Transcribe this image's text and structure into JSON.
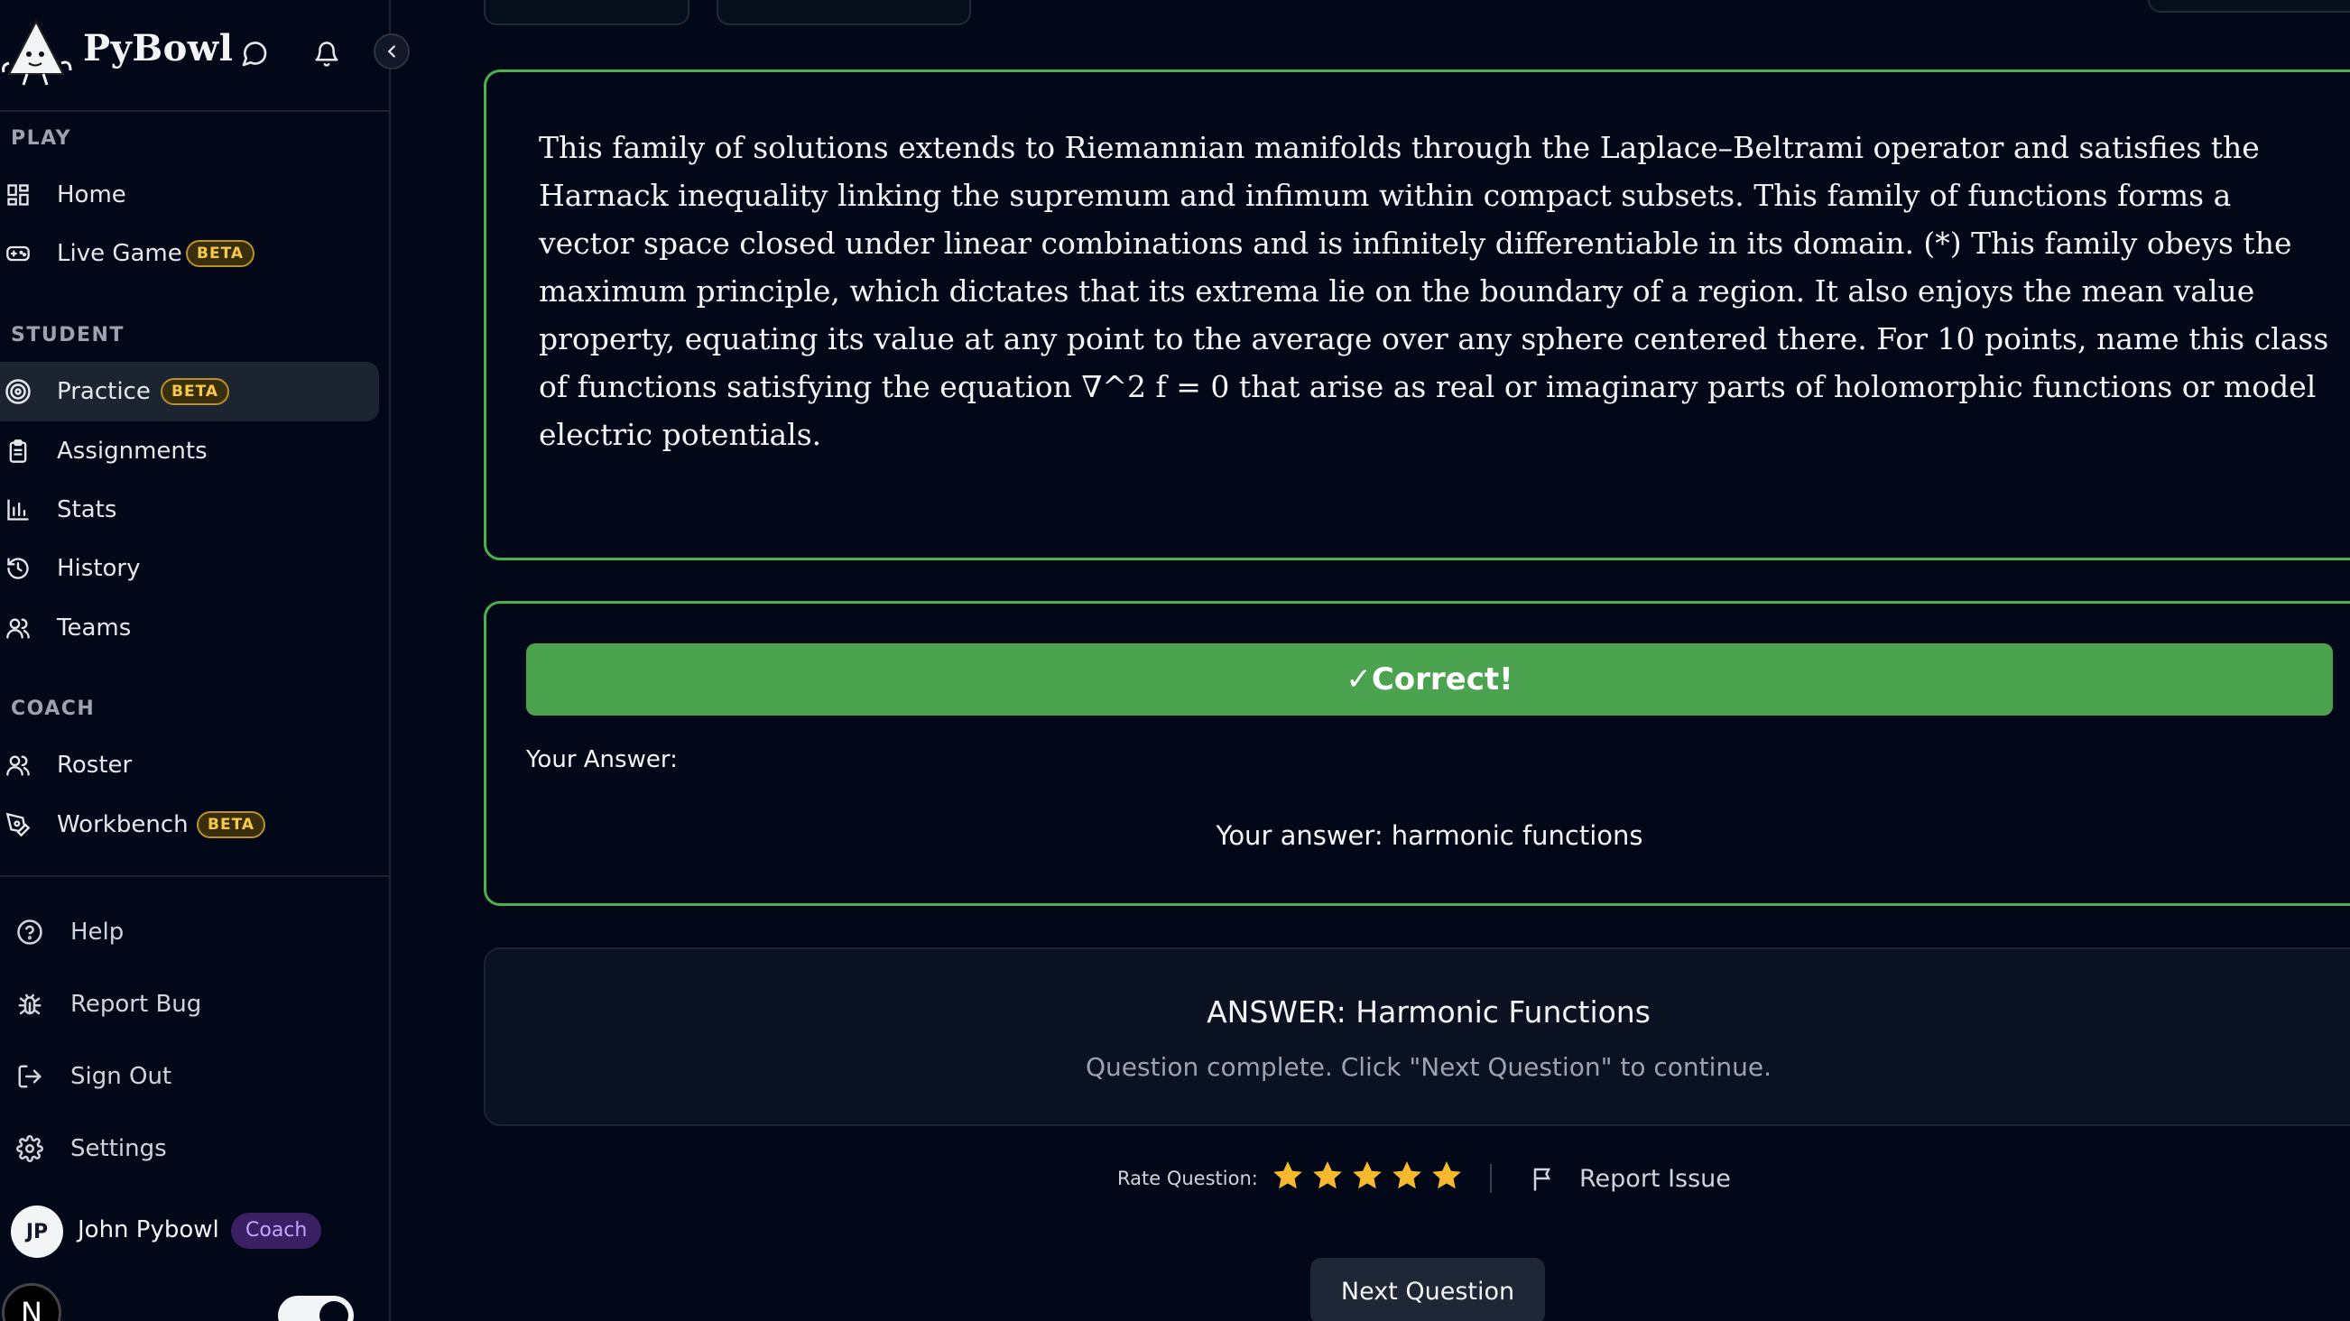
{
  "brand": {
    "name": "PyBowl"
  },
  "sidebar": {
    "sections": [
      {
        "title": "PLAY"
      },
      {
        "title": "STUDENT"
      },
      {
        "title": "COACH"
      }
    ],
    "play_items": [
      {
        "label": "Home",
        "icon": "grid-icon"
      },
      {
        "label": "Live Game",
        "icon": "gamepad-icon",
        "badge": "BETA"
      }
    ],
    "student_items": [
      {
        "label": "Practice",
        "icon": "target-icon",
        "badge": "BETA",
        "active": true
      },
      {
        "label": "Assignments",
        "icon": "clipboard-icon"
      },
      {
        "label": "Stats",
        "icon": "bar-chart-icon"
      },
      {
        "label": "History",
        "icon": "history-icon"
      },
      {
        "label": "Teams",
        "icon": "users-icon"
      }
    ],
    "coach_items": [
      {
        "label": "Roster",
        "icon": "users-icon"
      },
      {
        "label": "Workbench",
        "icon": "pen-tool-icon",
        "badge": "BETA"
      }
    ],
    "utility_items": [
      {
        "label": "Help",
        "icon": "help-circle-icon"
      },
      {
        "label": "Report Bug",
        "icon": "bug-icon"
      },
      {
        "label": "Sign Out",
        "icon": "log-out-icon"
      },
      {
        "label": "Settings",
        "icon": "gear-icon"
      }
    ],
    "user": {
      "initials": "JP",
      "name": "John Pybowl",
      "role": "Coach"
    },
    "n_badge": "N"
  },
  "question": {
    "text": "This family of solutions extends to Riemannian manifolds through the Laplace–Beltrami operator and satisfies the Harnack inequality linking the supremum and infimum within compact subsets. This family of functions forms a vector space closed under linear combinations and is infinitely differentiable in its domain. (*) This family obeys the maximum principle, which dictates that its extrema lie on the boundary of a region. It also enjoys the mean value property, equating its value at any point to the average over any sphere centered there. For 10 points, name this class of functions satisfying the equation ∇^2 f = 0 that arise as real or imaginary parts of holomorphic functions or model electric potentials."
  },
  "result": {
    "banner": "✓Correct!",
    "your_answer_label": "Your Answer:",
    "your_answer_value": "Your answer: harmonic functions"
  },
  "answer": {
    "title": "ANSWER: Harmonic Functions",
    "subtitle": "Question complete. Click \"Next Question\" to continue."
  },
  "rating": {
    "label": "Rate Question:",
    "stars": 5,
    "max": 5,
    "report_label": "Report Issue"
  },
  "next_button": "Next Question",
  "colors": {
    "accent_green": "#4caf50",
    "banner_green": "#4ba34f",
    "star_gold": "#f5b82e",
    "beta_gold": "#f7c948",
    "coach_purple": "#c4a4ff"
  }
}
